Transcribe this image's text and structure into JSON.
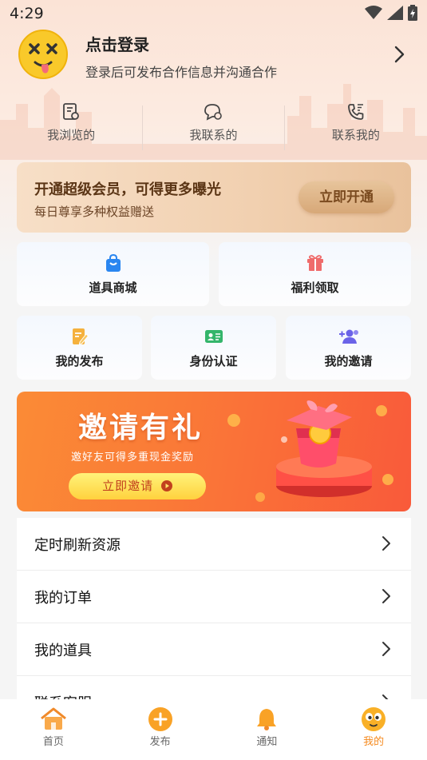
{
  "status_bar": {
    "time": "4:29"
  },
  "profile": {
    "title": "点击登录",
    "subtitle": "登录后可发布合作信息并沟通合作"
  },
  "stats": [
    {
      "label": "我浏览的",
      "icon": "browse-history-icon"
    },
    {
      "label": "我联系的",
      "icon": "chat-contact-icon"
    },
    {
      "label": "联系我的",
      "icon": "phone-incoming-icon"
    }
  ],
  "vip": {
    "title": "开通超级会员，可得更多曝光",
    "subtitle": "每日尊享多种权益赠送",
    "button": "立即开通"
  },
  "tools": [
    {
      "label": "道具商城",
      "icon": "shopping-bag-icon",
      "color": "#2a86f0"
    },
    {
      "label": "福利领取",
      "icon": "gift-icon",
      "color": "#ef6b6b"
    }
  ],
  "features": [
    {
      "label": "我的发布",
      "icon": "edit-note-icon",
      "color": "#f5b13d"
    },
    {
      "label": "身份认证",
      "icon": "id-card-icon",
      "color": "#34b56b"
    },
    {
      "label": "我的邀请",
      "icon": "invite-users-icon",
      "color": "#6b63e8"
    }
  ],
  "banner": {
    "title": "邀请有礼",
    "subtitle": "邀好友可得多重现金奖励",
    "button": "立即邀请"
  },
  "menu": [
    {
      "label": "定时刷新资源"
    },
    {
      "label": "我的订单"
    },
    {
      "label": "我的道具"
    },
    {
      "label": "联系客服"
    }
  ],
  "tabs": [
    {
      "label": "首页",
      "icon": "home-icon"
    },
    {
      "label": "发布",
      "icon": "add-circle-icon"
    },
    {
      "label": "通知",
      "icon": "bell-icon"
    },
    {
      "label": "我的",
      "icon": "profile-face-icon",
      "active": true
    }
  ],
  "colors": {
    "accent": "#f58a1f",
    "vip_text": "#5b3515",
    "banner": "#fa7a37"
  }
}
